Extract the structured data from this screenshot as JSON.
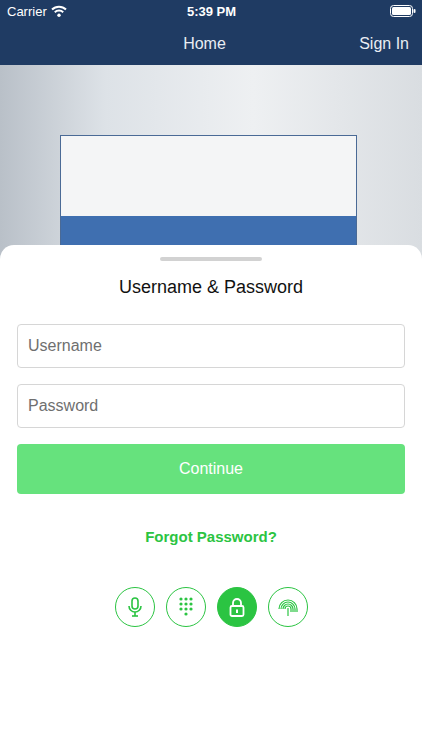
{
  "status_bar": {
    "carrier": "Carrier",
    "time": "5:39 PM"
  },
  "nav": {
    "title": "Home",
    "action": "Sign In"
  },
  "sheet": {
    "title": "Username & Password",
    "fields": [
      {
        "placeholder": "Username"
      },
      {
        "placeholder": "Password"
      }
    ],
    "continue": {
      "label": "Continue",
      "disabled": true
    },
    "forgot": "Forgot Password?"
  },
  "auth_methods": [
    {
      "kind": "voice",
      "selected": false
    },
    {
      "kind": "pin",
      "selected": false
    },
    {
      "kind": "password",
      "selected": true
    },
    {
      "kind": "fingerprint",
      "selected": false
    }
  ]
}
